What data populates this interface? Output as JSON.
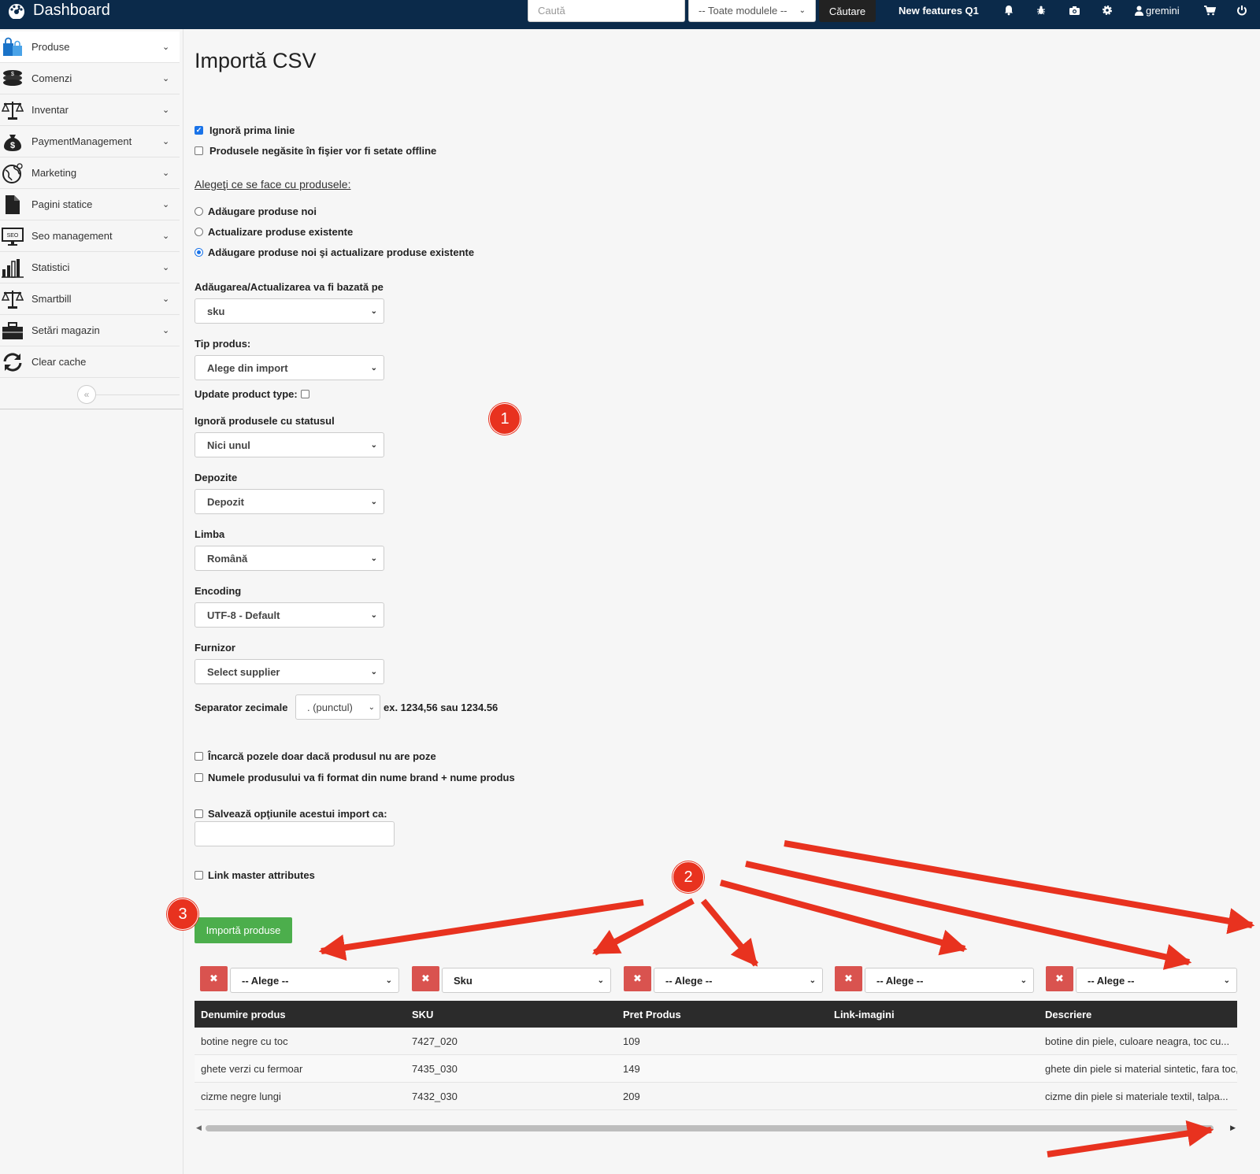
{
  "topbar": {
    "brand": "Dashboard",
    "search_placeholder": "Caută",
    "modules_select": "-- Toate modulele --",
    "search_button": "Căutare",
    "new_features": "New features Q1",
    "username": "gremini",
    "icons": [
      "bell-icon",
      "bug-icon",
      "camera-icon",
      "gear-icon",
      "user-icon",
      "cart-icon",
      "power-icon"
    ]
  },
  "sidebar": {
    "items": [
      {
        "label": "Produse",
        "icon": "shopping-bags-icon"
      },
      {
        "label": "Comenzi",
        "icon": "coins-icon"
      },
      {
        "label": "Inventar",
        "icon": "scale-icon"
      },
      {
        "label": "PaymentManagement",
        "icon": "money-bag-icon"
      },
      {
        "label": "Marketing",
        "icon": "globe-icon"
      },
      {
        "label": "Pagini statice",
        "icon": "file-icon"
      },
      {
        "label": "Seo management",
        "icon": "seo-monitor-icon"
      },
      {
        "label": "Statistici",
        "icon": "bar-chart-icon"
      },
      {
        "label": "Smartbill",
        "icon": "scale-icon"
      },
      {
        "label": "Setări magazin",
        "icon": "toolbox-icon"
      },
      {
        "label": "Clear cache",
        "icon": "refresh-icon"
      }
    ],
    "collapse": "«"
  },
  "main": {
    "title": "Importă CSV",
    "ignore_first_line": "Ignoră prima linie",
    "missing_offline": "Produsele negăsite în fişier vor fi setate offline",
    "choose_label": "Alegeţi ce se face cu produsele:",
    "radio_add": "Adăugare produse noi",
    "radio_update": "Actualizare produse existente",
    "radio_both": "Adăugare produse noi şi actualizare produse existente",
    "based_on_label": "Adăugarea/Actualizarea va fi bazată pe",
    "based_on_value": "sku",
    "product_type_label": "Tip produs:",
    "product_type_value": "Alege din import",
    "update_type_label": "Update product type:",
    "ignore_status_label": "Ignoră produsele cu statusul",
    "ignore_status_value": "Nici unul",
    "warehouses_label": "Depozite",
    "warehouses_value": "Depozit",
    "language_label": "Limba",
    "language_value": "Română",
    "encoding_label": "Encoding",
    "encoding_value": "UTF-8 - Default",
    "supplier_label": "Furnizor",
    "supplier_value": "Select supplier",
    "separator_label": "Separator zecimale",
    "separator_value": ". (punctul)",
    "separator_example": "ex. 1234,56 sau 1234.56",
    "images_only": "Încarcă pozele doar dacă produsul nu are poze",
    "name_format": "Numele produsului va fi format din nume brand + nume produs",
    "save_options": "Salvează opţiunile acestui import ca:",
    "link_master": "Link master attributes",
    "import_button": "Importă produse"
  },
  "mapping": [
    "-- Alege --",
    "Sku",
    "-- Alege --",
    "-- Alege --",
    "-- Alege --"
  ],
  "table": {
    "headers": [
      "Denumire produs",
      "SKU",
      "Pret Produs",
      "Link-imagini",
      "Descriere"
    ],
    "rows": [
      [
        "botine negre cu toc",
        "7427_020",
        "109",
        "",
        "botine din piele, culoare neagra, toc cu..."
      ],
      [
        "ghete verzi cu fermoar",
        "7435_030",
        "149",
        "",
        "ghete din piele si material sintetic, fara toc,..."
      ],
      [
        "cizme negre lungi",
        "7432_030",
        "209",
        "",
        "cizme din piele si materiale textil, talpa..."
      ]
    ]
  },
  "annotations": {
    "badge1": "1",
    "badge2": "2",
    "badge3": "3",
    "color": "#e8321f"
  }
}
